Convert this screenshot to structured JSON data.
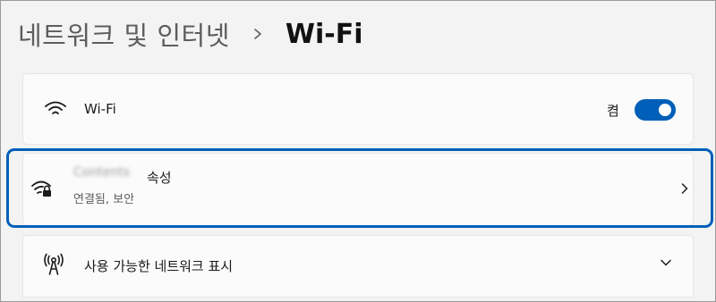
{
  "breadcrumb": {
    "parent": "네트워크 및 인터넷",
    "separator_icon": "chevron-right-icon",
    "current": "Wi-Fi"
  },
  "wifi_toggle_row": {
    "icon": "wifi-icon",
    "title": "Wi-Fi",
    "toggle_state_label": "켬",
    "toggle_on": true
  },
  "network_properties_row": {
    "icon": "wifi-secured-icon",
    "network_name": "Contents",
    "title_suffix": "속성",
    "status": "연결됨, 보안",
    "chevron_icon": "chevron-right-icon"
  },
  "available_networks_row": {
    "icon": "antenna-icon",
    "title": "사용 가능한 네트워크 표시",
    "chevron_icon": "chevron-down-icon"
  },
  "colors": {
    "accent": "#005fb8",
    "background": "#f3f3f3",
    "card": "#fbfbfb"
  }
}
